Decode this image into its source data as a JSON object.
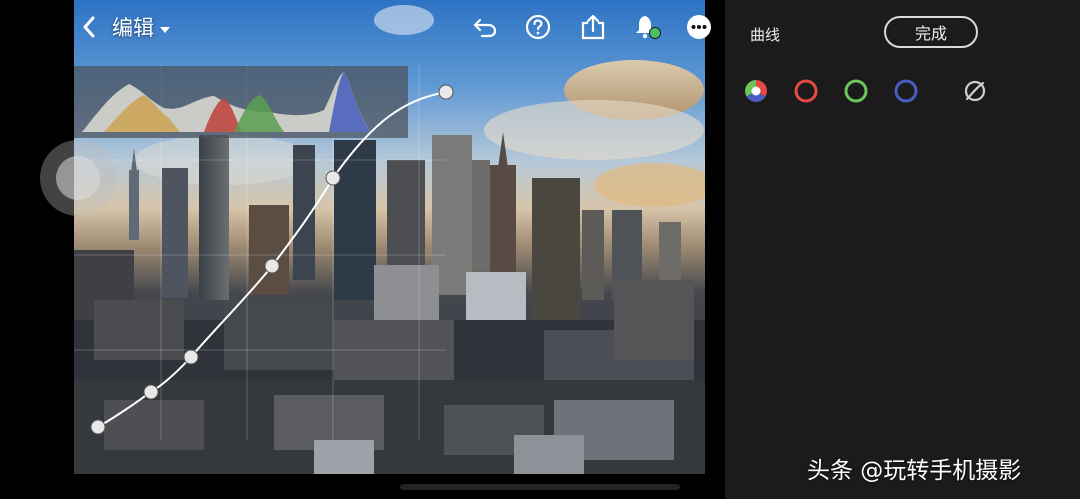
{
  "header": {
    "title": "编辑",
    "icons": [
      "back-icon",
      "chevron-down-icon",
      "undo-icon",
      "help-icon",
      "share-icon",
      "notification-icon",
      "more-icon"
    ]
  },
  "panel": {
    "title": "曲线",
    "done_label": "完成",
    "channels": [
      "rgb-channel",
      "red-channel",
      "green-channel",
      "blue-channel",
      "reset-channel"
    ],
    "colors": {
      "red": "#e64b43",
      "green": "#6dc45a",
      "blue": "#4a5bc2",
      "background": "#1b1b1b"
    }
  },
  "curve": {
    "control_points": [
      {
        "input": 0.04,
        "output": 0.05
      },
      {
        "input": 0.19,
        "output": 0.17
      },
      {
        "input": 0.25,
        "output": 0.27
      },
      {
        "input": 0.38,
        "output": 0.54
      },
      {
        "input": 0.48,
        "output": 0.72
      },
      {
        "input": 0.69,
        "output": 0.9
      }
    ]
  },
  "watermark": "头条 @玩转手机摄影"
}
